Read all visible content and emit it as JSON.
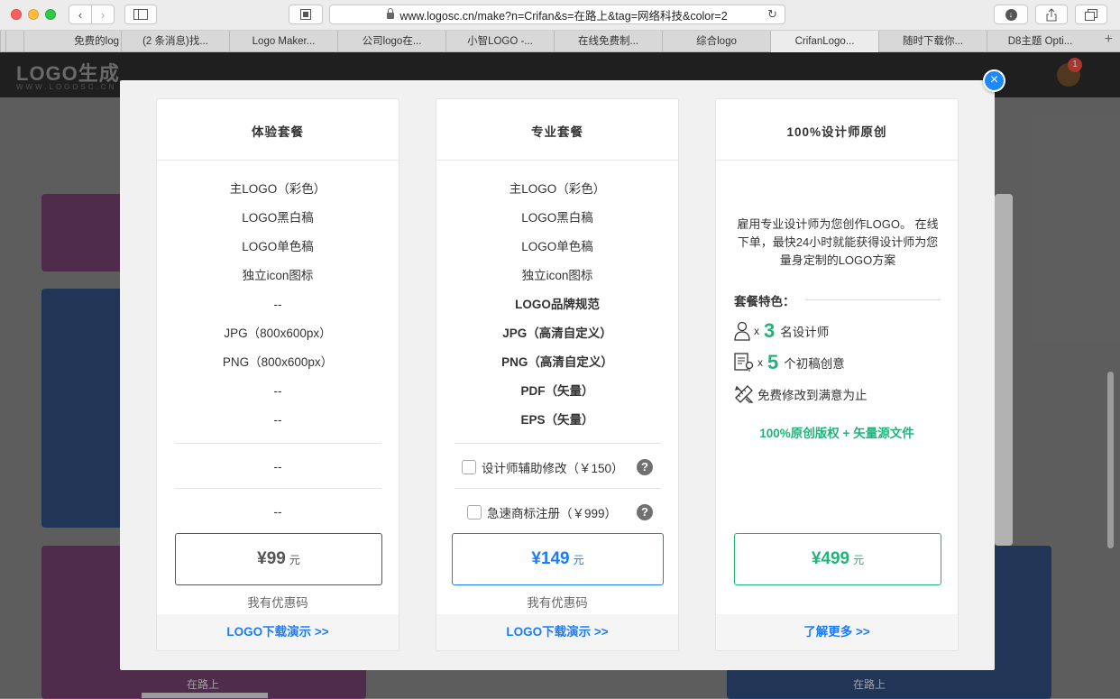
{
  "browser": {
    "url": "www.logosc.cn/make?n=Crifan&s=在路上&tag=网络科技&color=2",
    "tabs": [
      "免费的log",
      "(2 条消息)找...",
      "Logo Maker...",
      "公司logo在...",
      "小智LOGO -...",
      "在线免费制...",
      "综合logo",
      "CrifanLogo...",
      "随时下载你...",
      "D8主题 Opti..."
    ],
    "active_tab_index": 7
  },
  "site": {
    "logo": "LOGO生成",
    "logo_sub": "WWW.LOGOSC.CN",
    "notification_count": "1",
    "bg_label_1": "在路上",
    "bg_label_2": "在路上"
  },
  "modal": {
    "close_glyph": "×",
    "plans": [
      {
        "title": "体验套餐",
        "features": [
          "主LOGO（彩色）",
          "LOGO黑白稿",
          "LOGO单色稿",
          "独立icon图标",
          "--",
          "JPG（800x600px）",
          "PNG（800x600px）",
          "--",
          "--"
        ],
        "addons": [
          "--",
          "--"
        ],
        "price_symbol": "¥",
        "price": "99",
        "unit": "元",
        "coupon": "我有优惠码",
        "footer_link": "LOGO下载演示 >>"
      },
      {
        "title": "专业套餐",
        "features": [
          "主LOGO（彩色）",
          "LOGO黑白稿",
          "LOGO单色稿",
          "独立icon图标",
          "LOGO品牌规范",
          "JPG（高清自定义）",
          "PNG（高清自定义）",
          "PDF（矢量）",
          "EPS（矢量）"
        ],
        "addons": [
          "设计师辅助修改（￥150）",
          "急速商标注册（￥999）"
        ],
        "help_glyph": "?",
        "price_symbol": "¥",
        "price": "149",
        "unit": "元",
        "coupon": "我有优惠码",
        "footer_link": "LOGO下载演示 >>"
      },
      {
        "title": "100%设计师原创",
        "description": "雇用专业设计师为您创作LOGO。 在线下单，最快24小时就能获得设计师为您量身定制的LOGO方案",
        "features_label": "套餐特色：",
        "stats": [
          {
            "icon": "designer-icon",
            "times": "x",
            "num": "3",
            "label": "名设计师"
          },
          {
            "icon": "draft-idea-icon",
            "times": "x",
            "num": "5",
            "label": "个初稿创意"
          },
          {
            "icon": "pencil-ruler-icon",
            "times": "",
            "num": "",
            "label": "免费修改到满意为止"
          }
        ],
        "copyright": "100%原创版权 + 矢量源文件",
        "price_symbol": "¥",
        "price": "499",
        "unit": "元",
        "footer_link": "了解更多 >>"
      }
    ]
  },
  "colors": {
    "accent_blue": "#1b7cff",
    "accent_green": "#21b37a"
  }
}
